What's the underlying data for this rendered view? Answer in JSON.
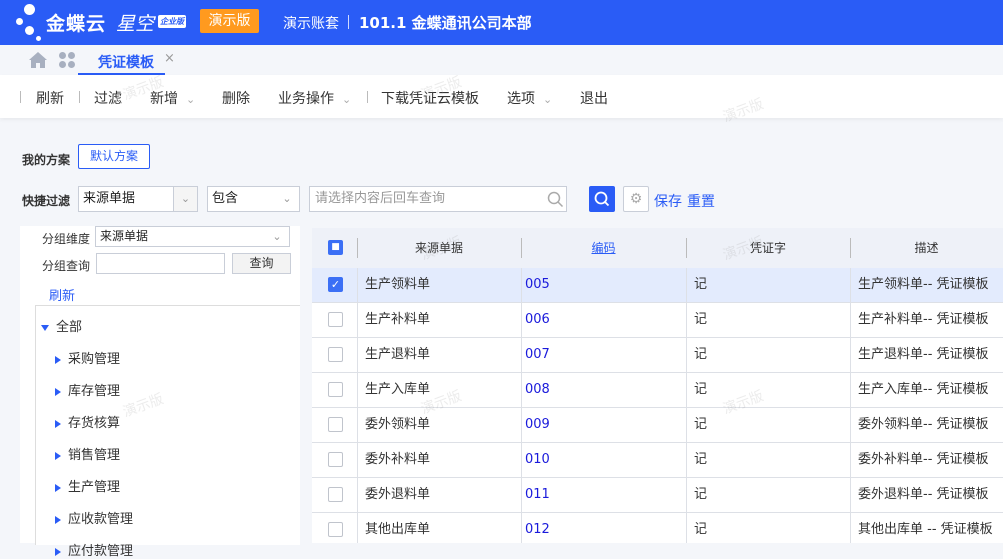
{
  "header": {
    "brand": "金蝶云",
    "brand_sub": "星空",
    "edition": "企业版",
    "demo_badge": "演示版",
    "account": "演示账套",
    "org": "101.1 金蝶通讯公司本部"
  },
  "tabs": [
    {
      "label": "凭证模板",
      "active": true
    }
  ],
  "toolbar": {
    "refresh": "刷新",
    "filter": "过滤",
    "add": "新增",
    "delete": "删除",
    "business": "业务操作",
    "download": "下载凭证云模板",
    "options": "选项",
    "exit": "退出"
  },
  "scheme": {
    "label": "我的方案",
    "default": "默认方案"
  },
  "quick_filter": {
    "label": "快捷过滤",
    "field": "来源单据",
    "operator": "包含",
    "placeholder": "请选择内容后回车查询",
    "save": "保存",
    "reset": "重置"
  },
  "left_panel": {
    "group_dim_label": "分组维度",
    "group_dim_value": "来源单据",
    "group_query_label": "分组查询",
    "group_query_value": "",
    "query_button": "查询",
    "refresh": "刷新",
    "tree": {
      "root": "全部",
      "children": [
        "采购管理",
        "库存管理",
        "存货核算",
        "销售管理",
        "生产管理",
        "应收款管理",
        "应付款管理"
      ]
    }
  },
  "grid": {
    "columns": [
      "来源单据",
      "编码",
      "凭证字",
      "描述"
    ],
    "rows": [
      {
        "checked": true,
        "source": "生产领料单",
        "code": "005",
        "word": "记",
        "desc": "生产领料单-- 凭证模板"
      },
      {
        "checked": false,
        "source": "生产补料单",
        "code": "006",
        "word": "记",
        "desc": "生产补料单-- 凭证模板"
      },
      {
        "checked": false,
        "source": "生产退料单",
        "code": "007",
        "word": "记",
        "desc": "生产退料单-- 凭证模板"
      },
      {
        "checked": false,
        "source": "生产入库单",
        "code": "008",
        "word": "记",
        "desc": "生产入库单-- 凭证模板"
      },
      {
        "checked": false,
        "source": "委外领料单",
        "code": "009",
        "word": "记",
        "desc": "委外领料单-- 凭证模板"
      },
      {
        "checked": false,
        "source": "委外补料单",
        "code": "010",
        "word": "记",
        "desc": "委外补料单-- 凭证模板"
      },
      {
        "checked": false,
        "source": "委外退料单",
        "code": "011",
        "word": "记",
        "desc": "委外退料单-- 凭证模板"
      },
      {
        "checked": false,
        "source": "其他出库单",
        "code": "012",
        "word": "记",
        "desc": "其他出库单 -- 凭证模板"
      }
    ]
  },
  "watermark": "演示版",
  "colors": {
    "primary": "#2a5cf6",
    "demo": "#ff9a1f",
    "selected_row": "#e3ebfd"
  }
}
